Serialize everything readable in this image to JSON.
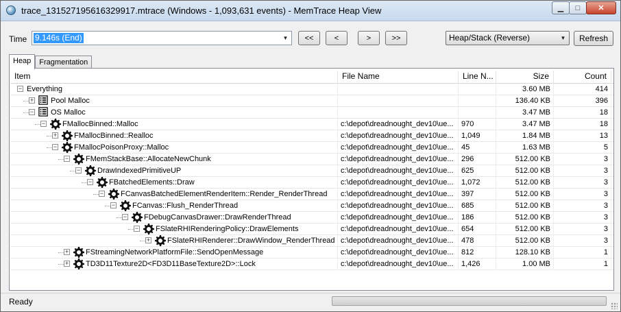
{
  "window": {
    "title": "trace_131527195616329917.mtrace (Windows - 1,093,631 events) - MemTrace Heap View",
    "minimize_glyph": "▁",
    "maximize_glyph": "□",
    "close_glyph": "✕"
  },
  "toolbar": {
    "time_label": "Time",
    "time_value": "9.146s (End)",
    "buttons": [
      "<<",
      "<",
      ">",
      ">>"
    ],
    "view_select": "Heap/Stack (Reverse)",
    "refresh_label": "Refresh"
  },
  "tabs": [
    {
      "label": "Heap",
      "active": true
    },
    {
      "label": "Fragmentation",
      "active": false
    }
  ],
  "table": {
    "columns": [
      "Item",
      "File Name",
      "Line N...",
      "Size",
      "Count"
    ],
    "rows": [
      {
        "label": "Everything",
        "level": 0,
        "expander": "−",
        "icon": "none",
        "file": "",
        "line": "",
        "size": "3.60 MB",
        "count": "414"
      },
      {
        "label": "Pool Malloc",
        "level": 1,
        "expander": "+",
        "icon": "grid-icon",
        "file": "",
        "line": "",
        "size": "136.40 KB",
        "count": "396"
      },
      {
        "label": "OS Malloc",
        "level": 1,
        "expander": "−",
        "icon": "grid-icon",
        "file": "",
        "line": "",
        "size": "3.47 MB",
        "count": "18"
      },
      {
        "label": "FMallocBinned::Malloc",
        "level": 2,
        "expander": "−",
        "icon": "gear-icon",
        "file": "c:\\depot\\dreadnought_dev10\\ue...",
        "line": "970",
        "size": "3.47 MB",
        "count": "18"
      },
      {
        "label": "FMallocBinned::Realloc",
        "level": 3,
        "expander": "+",
        "icon": "gear-icon",
        "file": "c:\\depot\\dreadnought_dev10\\ue...",
        "line": "1,049",
        "size": "1.84 MB",
        "count": "13"
      },
      {
        "label": "FMallocPoisonProxy::Malloc",
        "level": 3,
        "expander": "−",
        "icon": "gear-icon",
        "file": "c:\\depot\\dreadnought_dev10\\ue...",
        "line": "45",
        "size": "1.63 MB",
        "count": "5"
      },
      {
        "label": "FMemStackBase::AllocateNewChunk",
        "level": 4,
        "expander": "−",
        "icon": "gear-icon",
        "file": "c:\\depot\\dreadnought_dev10\\ue...",
        "line": "296",
        "size": "512.00 KB",
        "count": "3"
      },
      {
        "label": "DrawIndexedPrimitiveUP",
        "level": 5,
        "expander": "−",
        "icon": "gear-icon",
        "file": "c:\\depot\\dreadnought_dev10\\ue...",
        "line": "625",
        "size": "512.00 KB",
        "count": "3"
      },
      {
        "label": "FBatchedElements::Draw",
        "level": 6,
        "expander": "−",
        "icon": "gear-icon",
        "file": "c:\\depot\\dreadnought_dev10\\ue...",
        "line": "1,072",
        "size": "512.00 KB",
        "count": "3"
      },
      {
        "label": "FCanvasBatchedElementRenderItem::Render_RenderThread",
        "level": 7,
        "expander": "−",
        "icon": "gear-icon",
        "file": "c:\\depot\\dreadnought_dev10\\ue...",
        "line": "397",
        "size": "512.00 KB",
        "count": "3"
      },
      {
        "label": "FCanvas::Flush_RenderThread",
        "level": 8,
        "expander": "−",
        "icon": "gear-icon",
        "file": "c:\\depot\\dreadnought_dev10\\ue...",
        "line": "685",
        "size": "512.00 KB",
        "count": "3"
      },
      {
        "label": "FDebugCanvasDrawer::DrawRenderThread",
        "level": 9,
        "expander": "−",
        "icon": "gear-icon",
        "file": "c:\\depot\\dreadnought_dev10\\ue...",
        "line": "186",
        "size": "512.00 KB",
        "count": "3"
      },
      {
        "label": "FSlateRHIRenderingPolicy::DrawElements",
        "level": 10,
        "expander": "−",
        "icon": "gear-icon",
        "file": "c:\\depot\\dreadnought_dev10\\ue...",
        "line": "654",
        "size": "512.00 KB",
        "count": "3"
      },
      {
        "label": "FSlateRHIRenderer::DrawWindow_RenderThread",
        "level": 11,
        "expander": "+",
        "icon": "gear-icon",
        "file": "c:\\depot\\dreadnought_dev10\\ue...",
        "line": "478",
        "size": "512.00 KB",
        "count": "3"
      },
      {
        "label": "FStreamingNetworkPlatformFile::SendOpenMessage",
        "level": 4,
        "expander": "+",
        "icon": "gear-icon",
        "file": "c:\\depot\\dreadnought_dev10\\ue...",
        "line": "812",
        "size": "128.10 KB",
        "count": "1"
      },
      {
        "label": "TD3D11Texture2D<FD3D11BaseTexture2D>::Lock",
        "level": 4,
        "expander": "+",
        "icon": "gear-icon",
        "file": "c:\\depot\\dreadnought_dev10\\ue...",
        "line": "1,426",
        "size": "1.00 MB",
        "count": "1"
      }
    ]
  },
  "status": {
    "text": "Ready"
  }
}
